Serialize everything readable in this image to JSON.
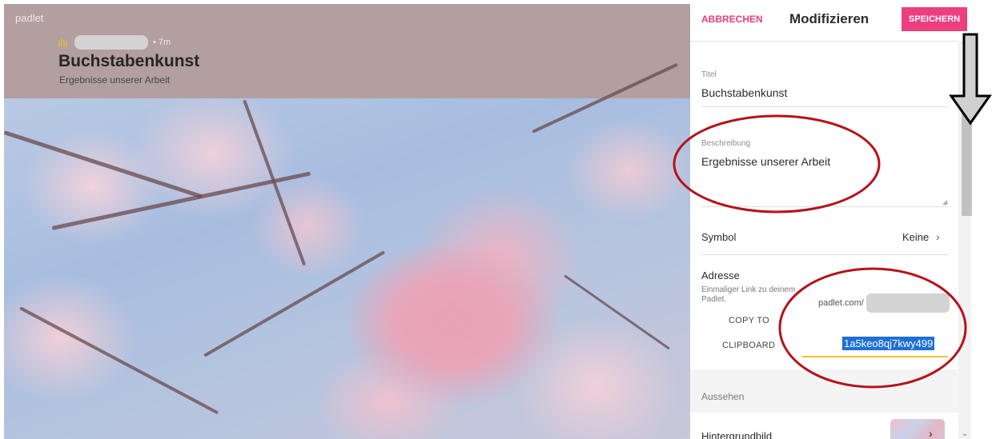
{
  "board": {
    "brand": "padlet",
    "author_time": "7m",
    "title": "Buchstabenkunst",
    "subtitle": "Ergebnisse unserer Arbeit"
  },
  "panel": {
    "cancel_label": "ABBRECHEN",
    "title": "Modifizieren",
    "save_label": "SPEICHERN",
    "title_field": {
      "label": "Titel",
      "value": "Buchstabenkunst"
    },
    "description_field": {
      "label": "Beschreibung",
      "value": "Ergebnisse unserer Arbeit"
    },
    "symbol": {
      "label": "Symbol",
      "value": "Keine"
    },
    "address": {
      "label": "Adresse",
      "hint": "Einmaliger Link zu deinem Padlet.",
      "domain": "padlet.com/",
      "copy_line1": "COPY TO",
      "copy_line2": "CLIPBOARD",
      "slug": "1a5keo8qj7kwy499"
    },
    "appearance_section": "Aussehen",
    "background": {
      "label": "Hintergrundbild"
    }
  },
  "colors": {
    "accent": "#ec3f7f",
    "header_bg": "#b39fa0",
    "annotation_red": "#b5121b",
    "selection_blue": "#1e6fd6",
    "underline_yellow": "#f3c12e"
  },
  "icons": {
    "chevron": "chevron-right-icon",
    "scroll_down": "scroll-down-arrow-icon",
    "annotation_arrow": "down-arrow-icon"
  }
}
